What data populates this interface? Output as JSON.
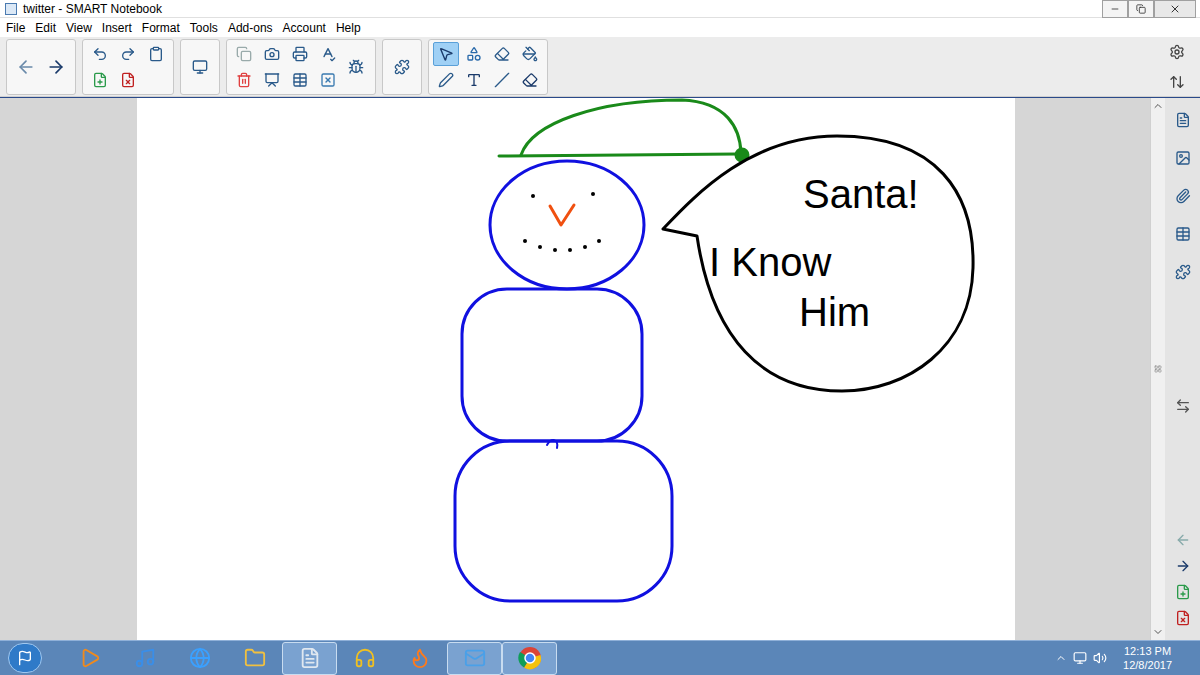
{
  "window": {
    "title": "twitter - SMART Notebook"
  },
  "menu": [
    "File",
    "Edit",
    "View",
    "Insert",
    "Format",
    "Tools",
    "Add-ons",
    "Account",
    "Help"
  ],
  "toolbar": {
    "tools": [
      {
        "selected": true
      },
      {
        "selected": false
      },
      {
        "selected": false
      },
      {
        "selected": false
      },
      {
        "selected": false
      },
      {
        "selected": false
      },
      {
        "selected": false
      },
      {
        "selected": false
      }
    ]
  },
  "canvas": {
    "speech_bubble": {
      "lines": [
        "Santa!",
        "I Know",
        "Him"
      ]
    }
  },
  "taskbar": {
    "apps": [
      {
        "running": false
      },
      {
        "running": false
      },
      {
        "running": false
      },
      {
        "running": false
      },
      {
        "running": true
      },
      {
        "running": false
      },
      {
        "running": false
      },
      {
        "running": true
      },
      {
        "running": true
      }
    ],
    "time": "12:13 PM",
    "date": "12/8/2017"
  }
}
